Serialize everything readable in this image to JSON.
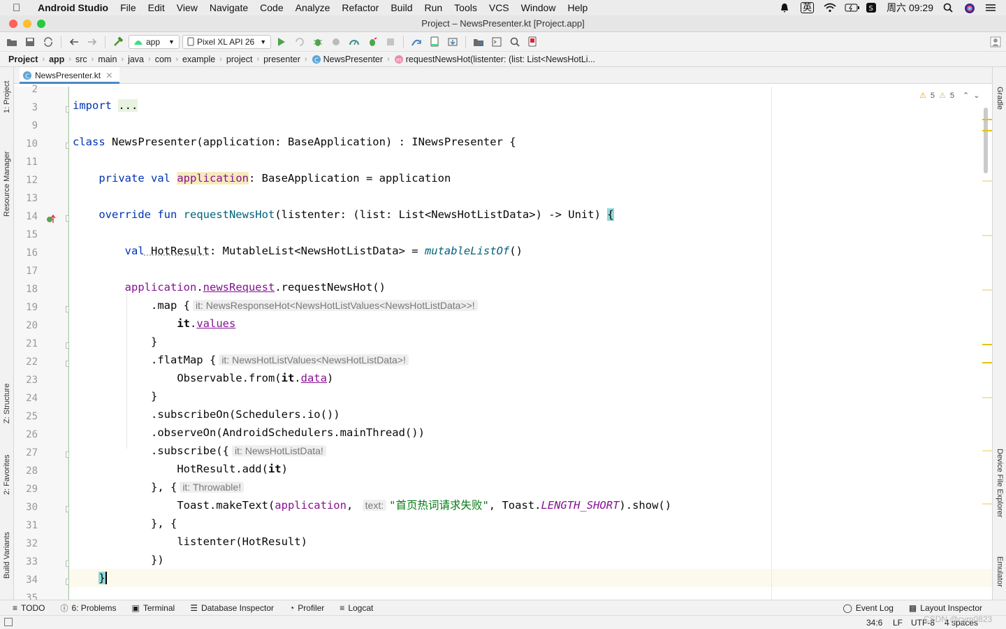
{
  "menubar": {
    "app_name": "Android Studio",
    "items": [
      "File",
      "Edit",
      "View",
      "Navigate",
      "Code",
      "Analyze",
      "Refactor",
      "Build",
      "Run",
      "Tools",
      "VCS",
      "Window",
      "Help"
    ],
    "input_method": "英",
    "clock": "周六 09:29"
  },
  "window": {
    "title": "Project – NewsPresenter.kt [Project.app]"
  },
  "toolbar": {
    "config": "app",
    "device": "Pixel XL API 26"
  },
  "breadcrumbs": [
    "Project",
    "app",
    "src",
    "main",
    "java",
    "com",
    "example",
    "project",
    "presenter",
    "NewsPresenter",
    "requestNewsHot(listenter: (list: List<NewsHotLi..."
  ],
  "left_tools": [
    "1: Project",
    "Resource Manager",
    "Z: Structure",
    "2: Favorites",
    "Build Variants"
  ],
  "right_tools": [
    "Gradle",
    "Device File Explorer",
    "Emulator"
  ],
  "editor_tab": {
    "name": "NewsPresenter.kt"
  },
  "inspections": {
    "warnings": "5",
    "weak_warnings": "5"
  },
  "code": {
    "line_numbers": [
      "2",
      "3",
      "9",
      "10",
      "11",
      "12",
      "13",
      "14",
      "15",
      "16",
      "17",
      "18",
      "19",
      "20",
      "21",
      "22",
      "23",
      "24",
      "25",
      "26",
      "27",
      "28",
      "29",
      "30",
      "31",
      "32",
      "33",
      "34",
      "35"
    ],
    "l3_a": "import",
    "l3_b": "...",
    "l10_a": "class",
    "l10_b": " NewsPresenter(application: BaseApplication) : INewsPresenter {",
    "l12_a": "private val",
    "l12_b": "application",
    "l12_c": ": BaseApplication = application",
    "l14_a": "override fun",
    "l14_b": "requestNewsHot",
    "l14_c": "(listenter: (list: List<NewsHotListData>) -> Unit) ",
    "l14_d": "{",
    "l16_a": "val",
    "l16_b": " HotResult",
    "l16_c": ": MutableList<NewsHotListData> = ",
    "l16_d": "mutableListOf",
    "l16_e": "()",
    "l18_a": "application",
    "l18_b": ".",
    "l18_c": "newsRequest",
    "l18_d": ".requestNewsHot()",
    "l19_a": ".map {",
    "l19_hint": "it: NewsResponseHot<NewsHotListValues<NewsHotListData>>!",
    "l20_a": "it",
    "l20_b": ".",
    "l20_c": "values",
    "l21": "}",
    "l22_a": ".flatMap {",
    "l22_hint": "it: NewsHotListValues<NewsHotListData>!",
    "l23_a": "Observable.from(",
    "l23_b": "it",
    "l23_c": ".",
    "l23_d": "data",
    "l23_e": ")",
    "l24": "}",
    "l25": ".subscribeOn(Schedulers.io())",
    "l26": ".observeOn(AndroidSchedulers.mainThread())",
    "l27_a": ".subscribe({",
    "l27_hint": "it: NewsHotListData!",
    "l28_a": "HotResult.add(",
    "l28_b": "it",
    "l28_c": ")",
    "l29_a": "}, {",
    "l29_hint": "it: Throwable!",
    "l30_a": "Toast.makeText(",
    "l30_b": "application",
    "l30_c": ",",
    "l30_hint": "text:",
    "l30_d": "\"首页热词请求失败\"",
    "l30_e": ", Toast.",
    "l30_f": "LENGTH_SHORT",
    "l30_g": ").show()",
    "l31": "}, {",
    "l32": "listenter(HotResult)",
    "l33": "})",
    "l34": "}"
  },
  "bottom_tools": [
    "TODO",
    "6: Problems",
    "Terminal",
    "Database Inspector",
    "Profiler",
    "Logcat"
  ],
  "bottom_right_tools": [
    "Event Log",
    "Layout Inspector"
  ],
  "status": {
    "position": "34:6",
    "line_sep": "LF",
    "encoding": "UTF-8",
    "indent": "4 spaces",
    "watermark": "CSDN @cym0823"
  },
  "colors": {
    "keyword": "#0033b3",
    "function": "#00627a",
    "property": "#871094",
    "string": "#067d17",
    "caret_line": "#fcfaed"
  }
}
